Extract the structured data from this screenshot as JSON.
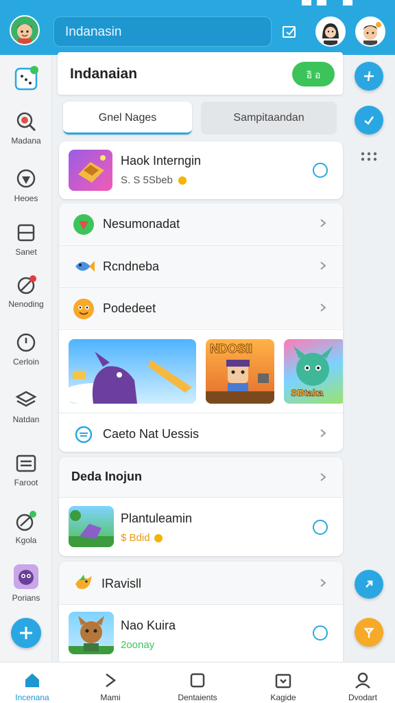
{
  "search": {
    "value": "Indanasin"
  },
  "header_card": {
    "title": "Indanaian",
    "pill_label": "อิ อ"
  },
  "tabs": [
    {
      "label": "Gnel Nages",
      "active": true
    },
    {
      "label": "Sampitaandan",
      "active": false
    }
  ],
  "featured": {
    "title": "Haok Interngin",
    "price": "S. S 5Sbeb"
  },
  "list": [
    {
      "label": "Nesumonadat",
      "icon": "shield-icon"
    },
    {
      "label": "Rcndneba",
      "icon": "fish-icon"
    },
    {
      "label": "Podedeet",
      "icon": "face-icon"
    }
  ],
  "banners": [
    {
      "text": ""
    },
    {
      "text": "NDOSII"
    },
    {
      "text": "SBtaka"
    }
  ],
  "cheat_row": {
    "label": "Caeto Nat Uessis"
  },
  "section": {
    "title": "Deda Inojun"
  },
  "item1": {
    "title": "Plantuleamin",
    "price": "$ Bdid"
  },
  "section2": {
    "title": "IRavisll"
  },
  "item2": {
    "title": "Nao Kuira",
    "price": "2oonay"
  },
  "left_rail": [
    "",
    "Madana",
    "Heoes",
    "Sanet",
    "Nenoding",
    "Cerloin",
    "Natdan",
    "Faroot",
    "Kgola",
    "Porians"
  ],
  "bottom_nav": [
    "Incenana",
    "Mami",
    "Dentaients",
    "Kagide",
    "Dvodart"
  ],
  "colors": {
    "primary": "#29a8e0",
    "green": "#3cc45a",
    "orange": "#f7a928"
  }
}
